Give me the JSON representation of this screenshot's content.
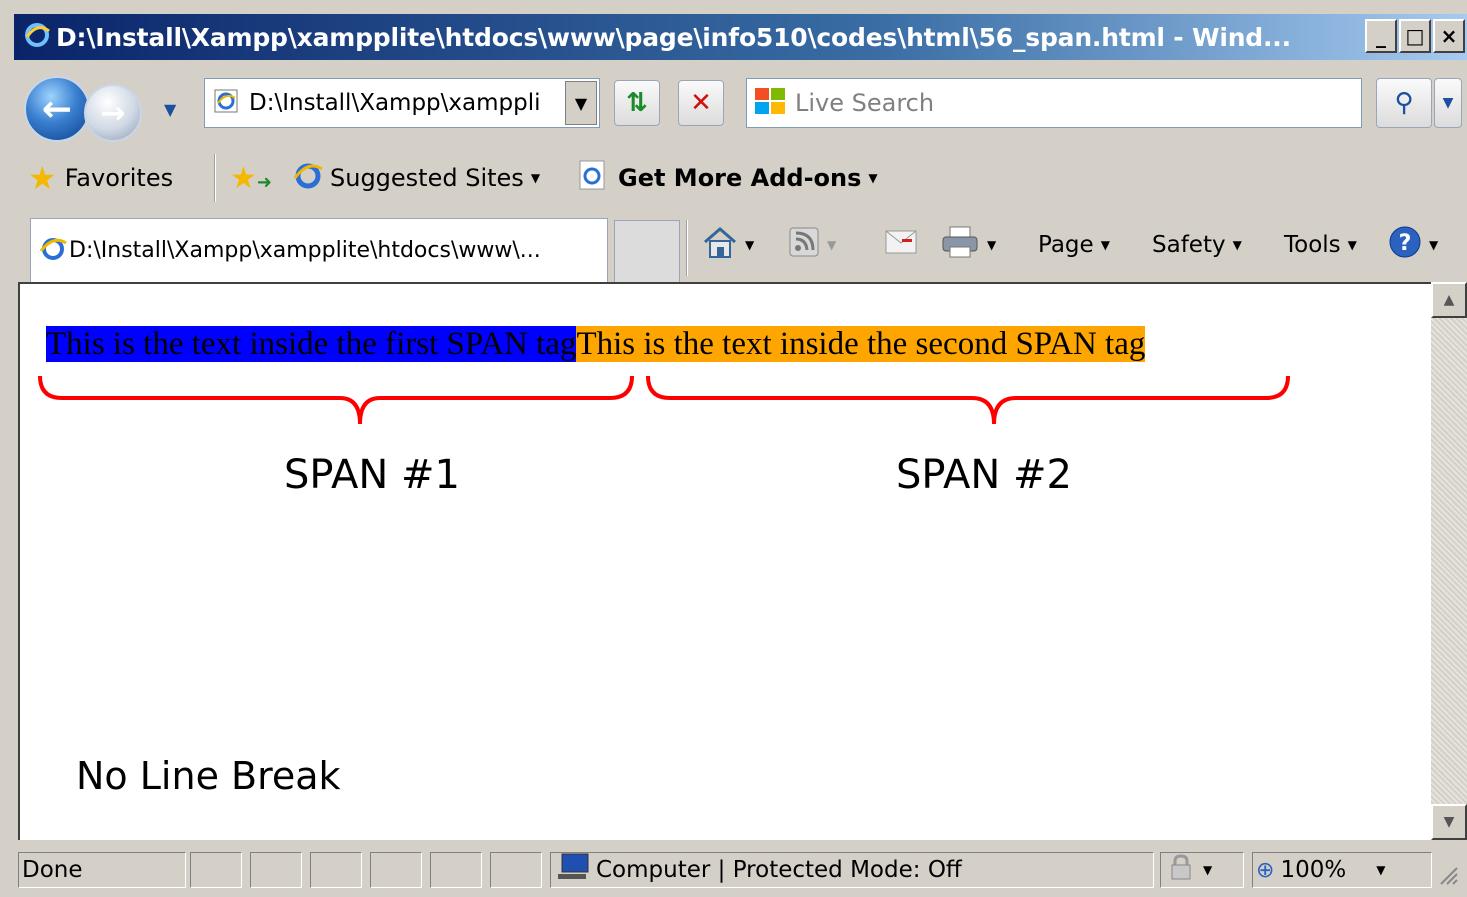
{
  "window": {
    "title": "D:\\Install\\Xampp\\xampplite\\htdocs\\www\\page\\info510\\codes\\html\\56_span.html - Wind...",
    "minimize": "_",
    "maximize": "□",
    "close": "×"
  },
  "toolbar": {
    "address": "D:\\Install\\Xampp\\xamppli",
    "search_placeholder": "Live Search"
  },
  "favorites_bar": {
    "favorites_label": "Favorites",
    "suggested_sites_label": "Suggested Sites",
    "addons_label": "Get More Add-ons"
  },
  "tabs": [
    {
      "label": "D:\\Install\\Xampp\\xampplite\\htdocs\\www\\..."
    }
  ],
  "command_bar": {
    "page_label": "Page",
    "safety_label": "Safety",
    "tools_label": "Tools"
  },
  "content": {
    "span1_text": "This is the text inside the first SPAN tag",
    "span2_text": "This is the text inside the second SPAN tag",
    "span1_label": "SPAN #1",
    "span2_label": "SPAN #2",
    "caption": "No Line Break",
    "span1_color": "#0000ff",
    "span2_color": "#ffa500",
    "brace_color": "#ff0000"
  },
  "status_bar": {
    "status": "Done",
    "zone": "Computer | Protected Mode: Off",
    "zoom": "100%"
  }
}
